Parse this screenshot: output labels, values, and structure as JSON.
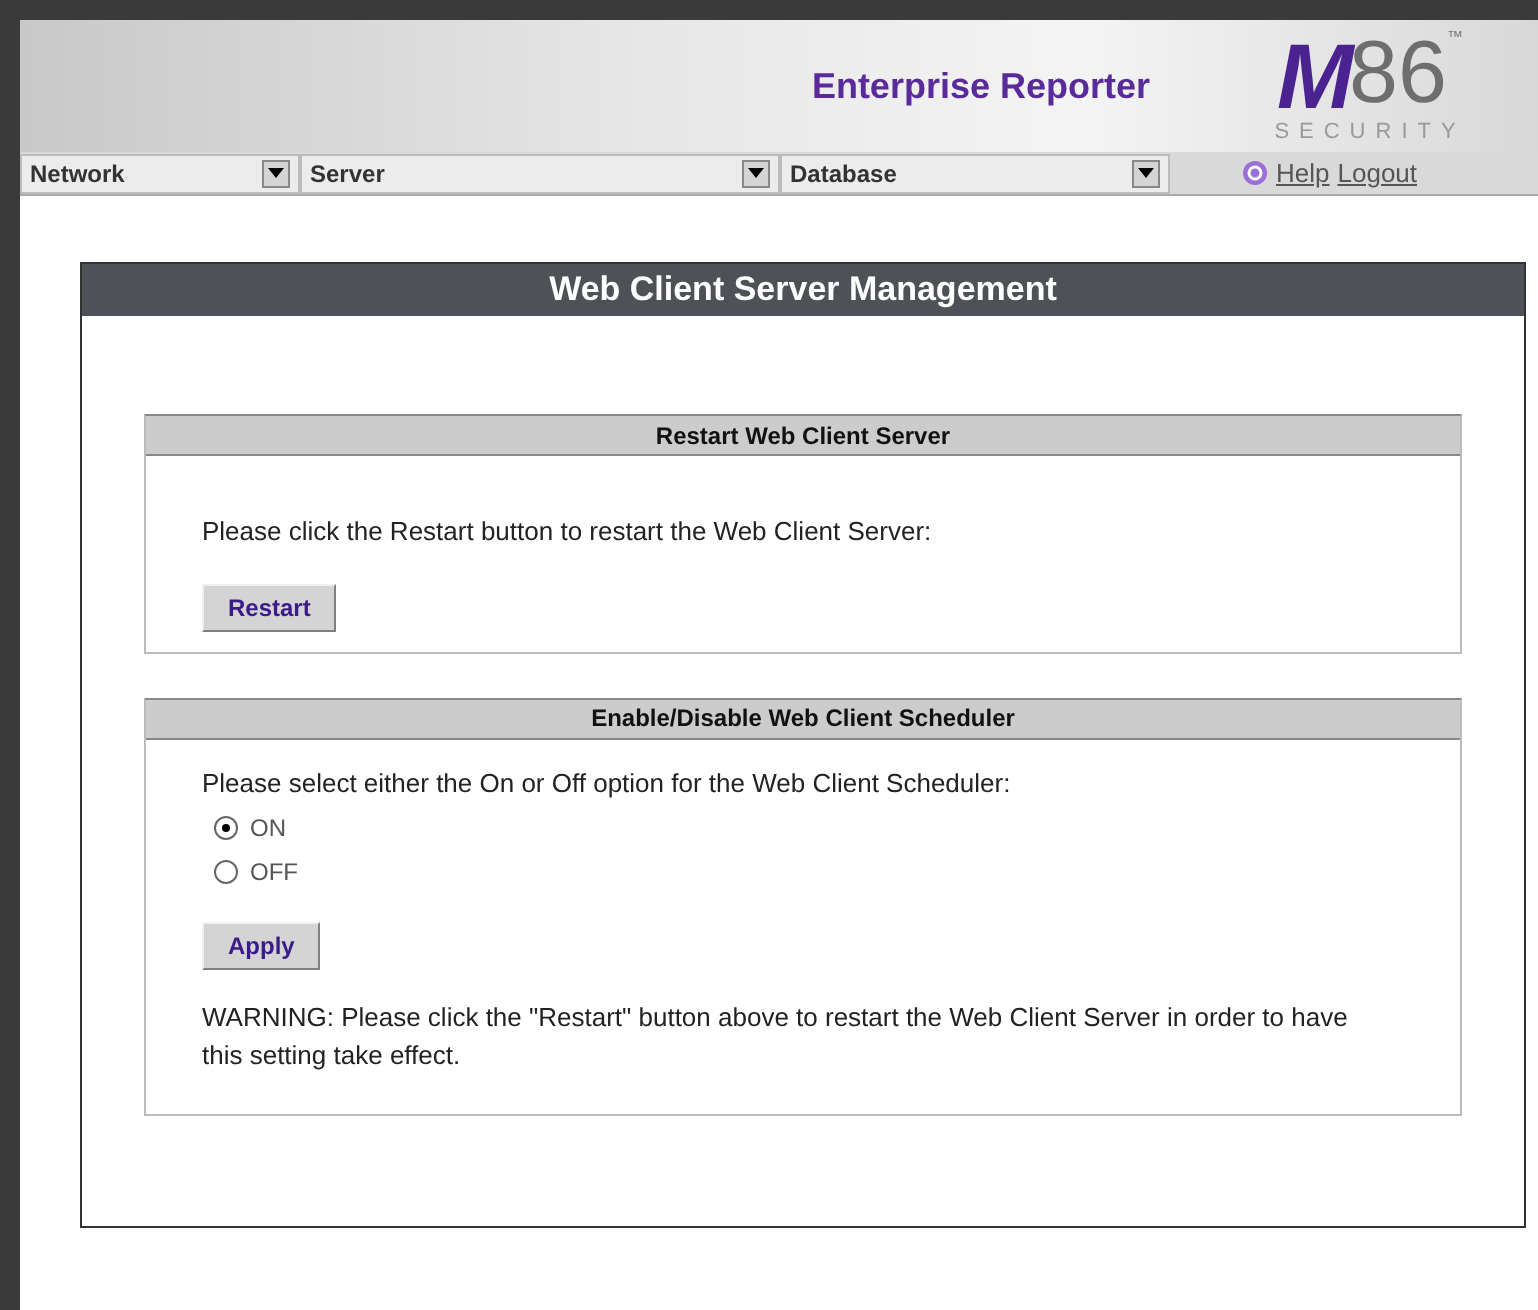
{
  "header": {
    "title": "Enterprise Reporter",
    "logo": {
      "mark": "M",
      "digits": "86",
      "tm": "™",
      "tagline": "SECURITY"
    }
  },
  "nav": {
    "menus": [
      {
        "label": "Network"
      },
      {
        "label": "Server"
      },
      {
        "label": "Database"
      }
    ],
    "links": [
      "Help",
      "Logout"
    ]
  },
  "panel": {
    "title": "Web Client Server Management",
    "sections": [
      {
        "title": "Restart Web Client Server",
        "text": "Please click the Restart button to restart the Web Client Server:",
        "button": "Restart"
      },
      {
        "title": "Enable/Disable Web Client Scheduler",
        "text": "Please select either the On or Off option for the Web Client Scheduler:",
        "options": [
          {
            "label": "ON",
            "selected": true
          },
          {
            "label": "OFF",
            "selected": false
          }
        ],
        "button": "Apply",
        "warning": "WARNING: Please click the \"Restart\" button above to restart the Web Client Server in order to have this setting take effect."
      }
    ]
  }
}
